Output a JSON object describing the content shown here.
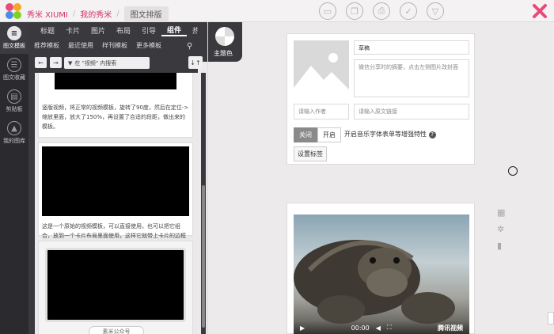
{
  "header": {
    "brand": "秀米 XIUMI",
    "crumb_mine": "我的秀米",
    "crumb_current": "图文排版",
    "toolbar_icons": [
      "folder-icon",
      "copy-icon",
      "print-icon",
      "check-icon",
      "send-icon"
    ]
  },
  "rail": [
    {
      "label": "图文模板",
      "icon": "menu-icon",
      "active": true
    },
    {
      "label": "图文收藏",
      "icon": "stack-icon",
      "active": false
    },
    {
      "label": "剪贴板",
      "icon": "clipboard-icon",
      "active": false
    },
    {
      "label": "我的图库",
      "icon": "image-icon",
      "active": false
    }
  ],
  "panel": {
    "tabs": [
      "标题",
      "卡片",
      "图片",
      "布局",
      "引导",
      "组件",
      "热门"
    ],
    "active_tab": "组件",
    "subtabs": [
      "推荐模板",
      "最近使用",
      "样刊模板",
      "更多模板"
    ],
    "theme_label": "主题色",
    "filter_label": "在 \"视频\" 内搜索",
    "back_icon": "←",
    "forward_icon": "→",
    "sort_icon": "↓↑",
    "search_icon": "⚲",
    "cards": [
      {
        "text": "竖版视频，将正常的视频模板，旋转了90度，然后在定位->缩放里面，放大了150%，再设置了合适的段距，做出来的模板。"
      },
      {
        "text": "这是一个原始的视频模板，可以直接使用，也可以把它组合，放到一个卡片布局里面使用，这样它就带上卡片的边框了。"
      },
      {
        "text": ""
      }
    ],
    "floating_button": "素米公众号"
  },
  "editor": {
    "draft_placeholder": "草稿",
    "summary_placeholder": "微信分享时的摘要，点击左侧图片改封面",
    "author_placeholder": "请输入作者",
    "source_placeholder": "请输入原文链接",
    "toggle_off": "关闭",
    "toggle_on": "开启",
    "toggle_label": "开启音乐字体表单等增强特性",
    "tag_button": "设置标签",
    "video_time": "00:00",
    "video_vendor": "腾讯视频"
  }
}
